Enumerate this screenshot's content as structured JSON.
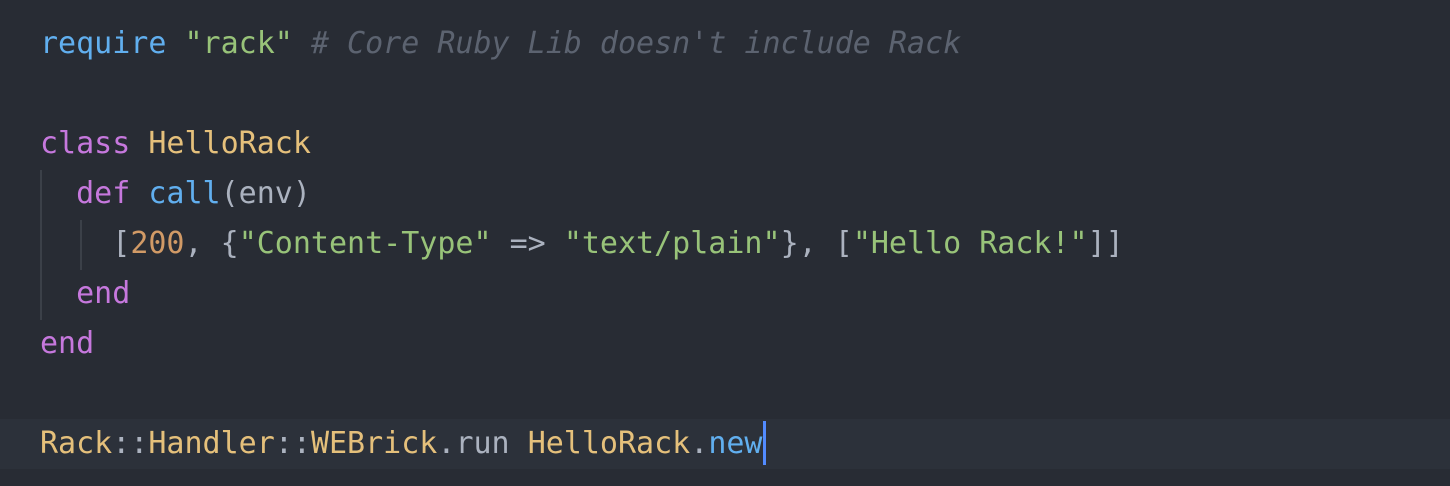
{
  "colors": {
    "background": "#282c34",
    "cursor_line": "#2c313a",
    "cursor": "#528bff",
    "builtin": "#61afef",
    "keyword": "#c678dd",
    "string": "#98c379",
    "comment": "#5c6370",
    "constant": "#e5c07b",
    "number": "#d19a66",
    "text": "#abb2bf"
  },
  "code": {
    "line1": {
      "require": "require",
      "str": "\"rack\"",
      "comment": "# Core Ruby Lib doesn't include Rack"
    },
    "line3": {
      "kw": "class",
      "name": "HelloRack"
    },
    "line4": {
      "kw": "def",
      "method": "call",
      "params": "(env)"
    },
    "line5": {
      "open": "[",
      "status": "200",
      "sep1": ", {",
      "key": "\"Content-Type\"",
      "arrow": " => ",
      "val": "\"text/plain\"",
      "sep2": "}, [",
      "body": "\"Hello Rack!\"",
      "close": "]]"
    },
    "line6": {
      "kw": "end"
    },
    "line7": {
      "kw": "end"
    },
    "line9": {
      "rack": "Rack",
      "sep1": "::",
      "handler": "Handler",
      "sep2": "::",
      "webrick": "WEBrick",
      "dot1": ".",
      "run": "run",
      "space": " ",
      "app": "HelloRack",
      "dot2": ".",
      "new": "new"
    }
  }
}
